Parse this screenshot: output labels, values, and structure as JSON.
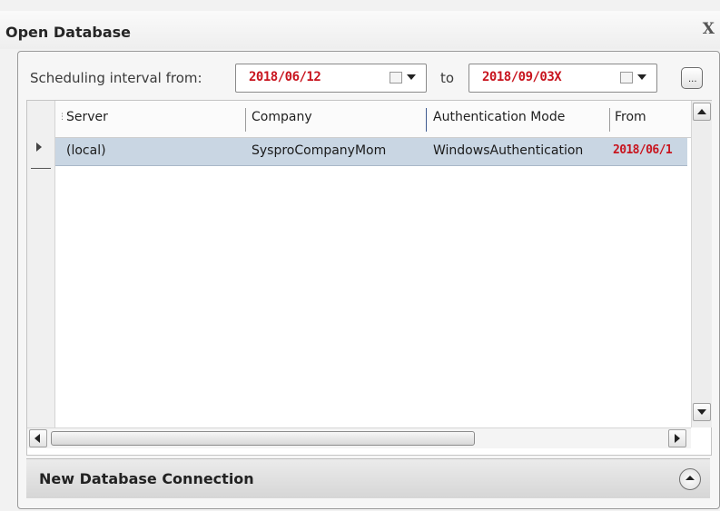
{
  "window": {
    "title": "Open Database",
    "close_glyph": "X"
  },
  "interval": {
    "label": "Scheduling interval from:",
    "from_value": "2018/06/12",
    "to_label": "to",
    "to_value": "2018/09/03",
    "to_suffix": "X",
    "button_label": "..."
  },
  "table": {
    "columns": [
      "Server",
      "Company",
      "Authentication Mode",
      "From"
    ],
    "rows": [
      {
        "server": "(local)",
        "company": "SysproCompanyMom",
        "auth": "WindowsAuthentication",
        "from": "2018/06/1"
      }
    ]
  },
  "bottom": {
    "label": "New Database Connection"
  },
  "colors": {
    "selected_row": "#c9d6e3",
    "redacted_text": "#c8141e"
  }
}
